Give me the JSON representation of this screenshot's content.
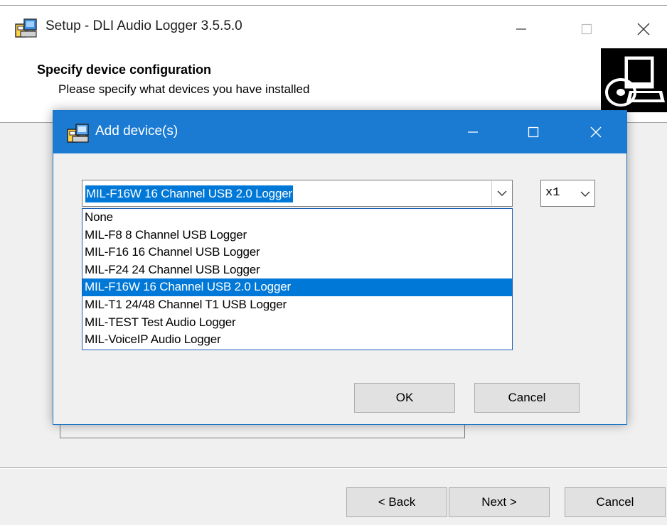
{
  "setup": {
    "title": "Setup - DLI Audio Logger 3.5.5.0",
    "heading": "Specify device configuration",
    "subheading": "Please specify what devices you have installed",
    "buttons": {
      "back": "< Back",
      "next": "Next >",
      "cancel": "Cancel"
    }
  },
  "dialog": {
    "title": "Add device(s)",
    "device_combo": {
      "selected_value": "MIL-F16W 16 Channel USB 2.0 Logger",
      "options": [
        "None",
        "MIL-F8 8 Channel USB Logger",
        "MIL-F16 16 Channel USB Logger",
        "MIL-F24 24 Channel USB Logger",
        "MIL-F16W 16 Channel USB 2.0 Logger",
        "MIL-T1 24/48 Channel T1 USB Logger",
        "MIL-TEST Test Audio Logger",
        "MIL-VoiceIP Audio Logger"
      ],
      "highlighted_index": 4
    },
    "count_select": {
      "selected_value": "x1"
    },
    "buttons": {
      "ok": "OK",
      "cancel": "Cancel"
    }
  },
  "icons": {
    "installer": "installer-icon",
    "setup_logo": "computer-disk-icon",
    "minimize": "minimize-icon",
    "maximize": "maximize-icon",
    "close": "close-icon",
    "dropdown": "chevron-down-icon"
  },
  "colors": {
    "dialog_titlebar": "#1b7bd3",
    "selection": "#0078d7",
    "window_bg": "#f0f0f0"
  }
}
